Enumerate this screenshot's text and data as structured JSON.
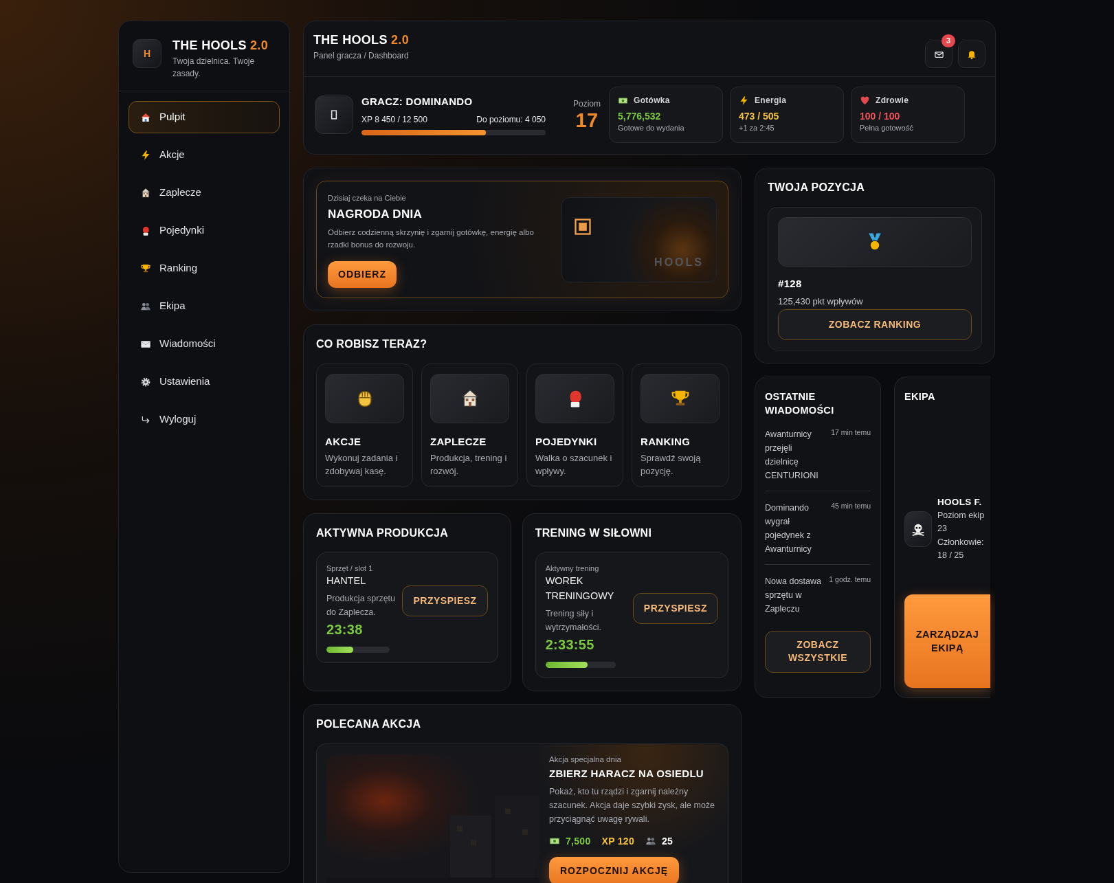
{
  "sidebar": {
    "logo_letter": "H",
    "title": "THE HOOLS",
    "version": "2.0",
    "tagline": "Twoja dzielnica. Twoje zasady.",
    "items": [
      {
        "label": "Pulpit",
        "kind": "house",
        "selected": true
      },
      {
        "label": "Akcje",
        "kind": "bolt",
        "selected": false
      },
      {
        "label": "Zaplecze",
        "kind": "building",
        "selected": false
      },
      {
        "label": "Pojedynki",
        "kind": "glove",
        "selected": false
      },
      {
        "label": "Ranking",
        "kind": "trophy",
        "selected": false
      },
      {
        "label": "Ekipa",
        "kind": "people",
        "selected": false
      },
      {
        "label": "Wiadomości",
        "kind": "envelope",
        "selected": false
      },
      {
        "label": "Ustawienia",
        "kind": "gear",
        "selected": false
      },
      {
        "label": "Wyloguj",
        "kind": "logout",
        "selected": false
      }
    ]
  },
  "header": {
    "title": "THE HOOLS",
    "version": "2.0",
    "breadcrumb": "Panel gracza / Dashboard",
    "mail_badge": "3"
  },
  "player": {
    "name": "GRACZ: DOMINANDO",
    "xp": "XP 8 450 / 12 500",
    "to_next": "Do poziomu: 4 050",
    "level": 0.676,
    "rank_label": "Poziom",
    "rank_value": "17"
  },
  "stats": [
    {
      "kind": "cash",
      "label": "Gotówka",
      "value": "5,776,532",
      "note": "Gotowe do wydania",
      "color": "#7cc843"
    },
    {
      "kind": "bolt",
      "label": "Energia",
      "value": "473 / 505",
      "note": "+1 za 2:45",
      "color": "#f5c542"
    },
    {
      "kind": "heart",
      "label": "Zdrowie",
      "value": "100 / 100",
      "note": "Pełna gotowość",
      "color": "#f0565b"
    }
  ],
  "daily_reward": {
    "eyebrow": "Dzisiaj czeka na Ciebie",
    "title": "NAGRODA DNIA",
    "text": "Odbierz codzienną skrzynię i zgarnij gotówkę, energię albo rzadki bonus do rozwoju.",
    "button": "ODBIERZ",
    "art_label": "HOOLS"
  },
  "actions": {
    "title": "CO ROBISZ TERAZ?",
    "items": [
      {
        "kind": "fist",
        "title": "AKCJE",
        "text": "Wykonuj zadania i zdobywaj kasę."
      },
      {
        "kind": "building",
        "title": "ZAPLECZE",
        "text": "Produkcja, trening i rozwój."
      },
      {
        "kind": "glove",
        "title": "POJEDYNKI",
        "text": "Walka o szacunek i wpływy."
      },
      {
        "kind": "trophy",
        "title": "RANKING",
        "text": "Sprawdź swoją pozycję."
      }
    ]
  },
  "timers": [
    {
      "title": "AKTYWNA PRODUKCJA",
      "eyebrow": "Sprzęt / slot 1",
      "name": "HANTEL",
      "text": "Produkcja sprzętu do Zaplecza.",
      "timer": "23:38",
      "level": 0.42,
      "button": "PRZYSPIESZ"
    },
    {
      "title": "TRENING W SIŁOWNI",
      "eyebrow": "Aktywny trening",
      "name": "WOREK TRENINGOWY",
      "text": "Trening siły i wytrzymałości.",
      "timer": "2:33:55",
      "level": 0.6,
      "button": "PRZYSPIESZ"
    }
  ],
  "featured": {
    "title": "POLECANA AKCJA",
    "eyebrow": "Akcja specjalna dnia",
    "name": "ZBIERZ HARACZ NA OSIEDLU",
    "text": "Pokaż, kto tu rządzi i zgarnij należny szacunek. Akcja daje szybki zysk, ale może przyciągnąć uwagę rywali.",
    "rewards": [
      {
        "kind": "cash",
        "value": "7,500",
        "color": "#7cc843"
      },
      {
        "kind": "xp",
        "value": "XP 120",
        "color": "#f5c542"
      },
      {
        "kind": "crew",
        "value": "25",
        "color": "#ffffff"
      }
    ],
    "button": "ROZPOCZNIJ AKCJĘ"
  },
  "position": {
    "title": "TWOJA POZYCJA",
    "rank": "#128",
    "points": "125,430 pkt wpływów",
    "button": "ZOBACZ RANKING"
  },
  "messages": {
    "title": "OSTATNIE WIADOMOŚCI",
    "items": [
      {
        "text": "Awanturnicy przejęli dzielnicę CENTURIONI",
        "time": "17 min temu"
      },
      {
        "text": "Dominando wygrał pojedynek z Awanturnicy",
        "time": "45 min temu"
      },
      {
        "text": "Nowa dostawa sprzętu w Zapleczu",
        "time": "1 godz. temu"
      }
    ],
    "button": "ZOBACZ WSZYSTKIE"
  },
  "crew": {
    "title": "EKIPA",
    "name": "HOOLS F.",
    "lines": [
      "Poziom ekip",
      "23",
      "Członkowie:",
      "18 / 25"
    ],
    "button": "ZARZĄDZAJ EKIPĄ"
  }
}
